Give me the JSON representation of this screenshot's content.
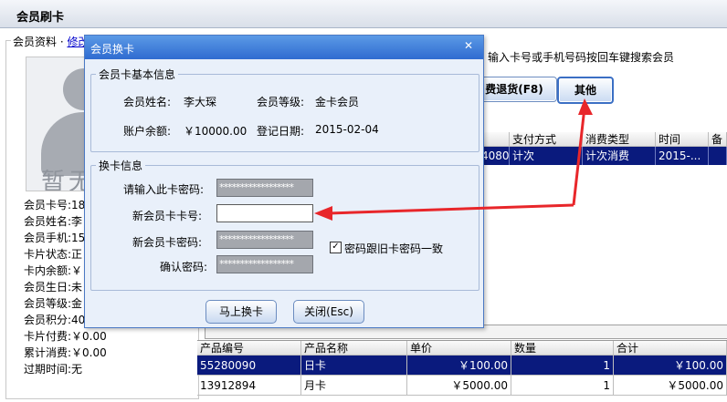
{
  "window": {
    "title": "会员刷卡"
  },
  "left": {
    "legend_prefix": "会员资料 · ",
    "legend_link": "修改",
    "photo_text": "暂无",
    "rows": [
      {
        "label": "会员卡号:",
        "value": "18"
      },
      {
        "label": "会员姓名:",
        "value": "李"
      },
      {
        "label": "会员手机:",
        "value": "15"
      },
      {
        "label": "卡片状态:",
        "value": "正"
      },
      {
        "label": "卡内余额:",
        "value": "￥"
      },
      {
        "label": "会员生日:",
        "value": "未"
      },
      {
        "label": "会员等级:",
        "value": "金"
      },
      {
        "label": "会员积分:",
        "value": "40"
      },
      {
        "label": "卡片付费:",
        "value": "￥0.00"
      },
      {
        "label": "累计消费:",
        "value": "￥0.00"
      },
      {
        "label": "过期时间:",
        "value": "无"
      }
    ]
  },
  "right": {
    "hint": "输入卡号或手机号码按回车键搜索会员",
    "refund_button": "费退货(F8)",
    "other_button": "其他"
  },
  "top_grid": {
    "headers": [
      "",
      "支付方式",
      "消费类型",
      "时间",
      "备"
    ],
    "row": [
      "4080",
      "计次",
      "计次消费",
      "2015-...",
      ""
    ]
  },
  "bottom_grid": {
    "headers": [
      "产品编号",
      "产品名称",
      "单价",
      "数量",
      "合计"
    ],
    "rows": [
      [
        "55280090",
        "日卡",
        "￥100.00",
        "1",
        "￥100.00"
      ],
      [
        "13912894",
        "月卡",
        "￥5000.00",
        "1",
        "￥5000.00"
      ]
    ]
  },
  "dialog": {
    "title": "会员换卡",
    "close": "✕",
    "basic_legend": "会员卡基本信息",
    "name_label": "会员姓名:",
    "name_value": "李大琛",
    "level_label": "会员等级:",
    "level_value": "金卡会员",
    "balance_label": "账户余额:",
    "balance_value": "￥10000.00",
    "reg_label": "登记日期:",
    "reg_value": "2015-02-04",
    "change_legend": "换卡信息",
    "pwd_label": "请输入此卡密码:",
    "pwd_value": "******************",
    "newcard_label": "新会员卡卡号:",
    "newcard_value": "",
    "newpwd_label": "新会员卡密码:",
    "newpwd_value": "******************",
    "confirm_label": "确认密码:",
    "confirm_value": "******************",
    "same_pwd_label": "密码跟旧卡密码一致",
    "same_pwd_checked": "✓",
    "submit_button": "马上换卡",
    "close_button": "关闭(Esc)"
  },
  "annotation": {
    "color": "#e8262a"
  }
}
